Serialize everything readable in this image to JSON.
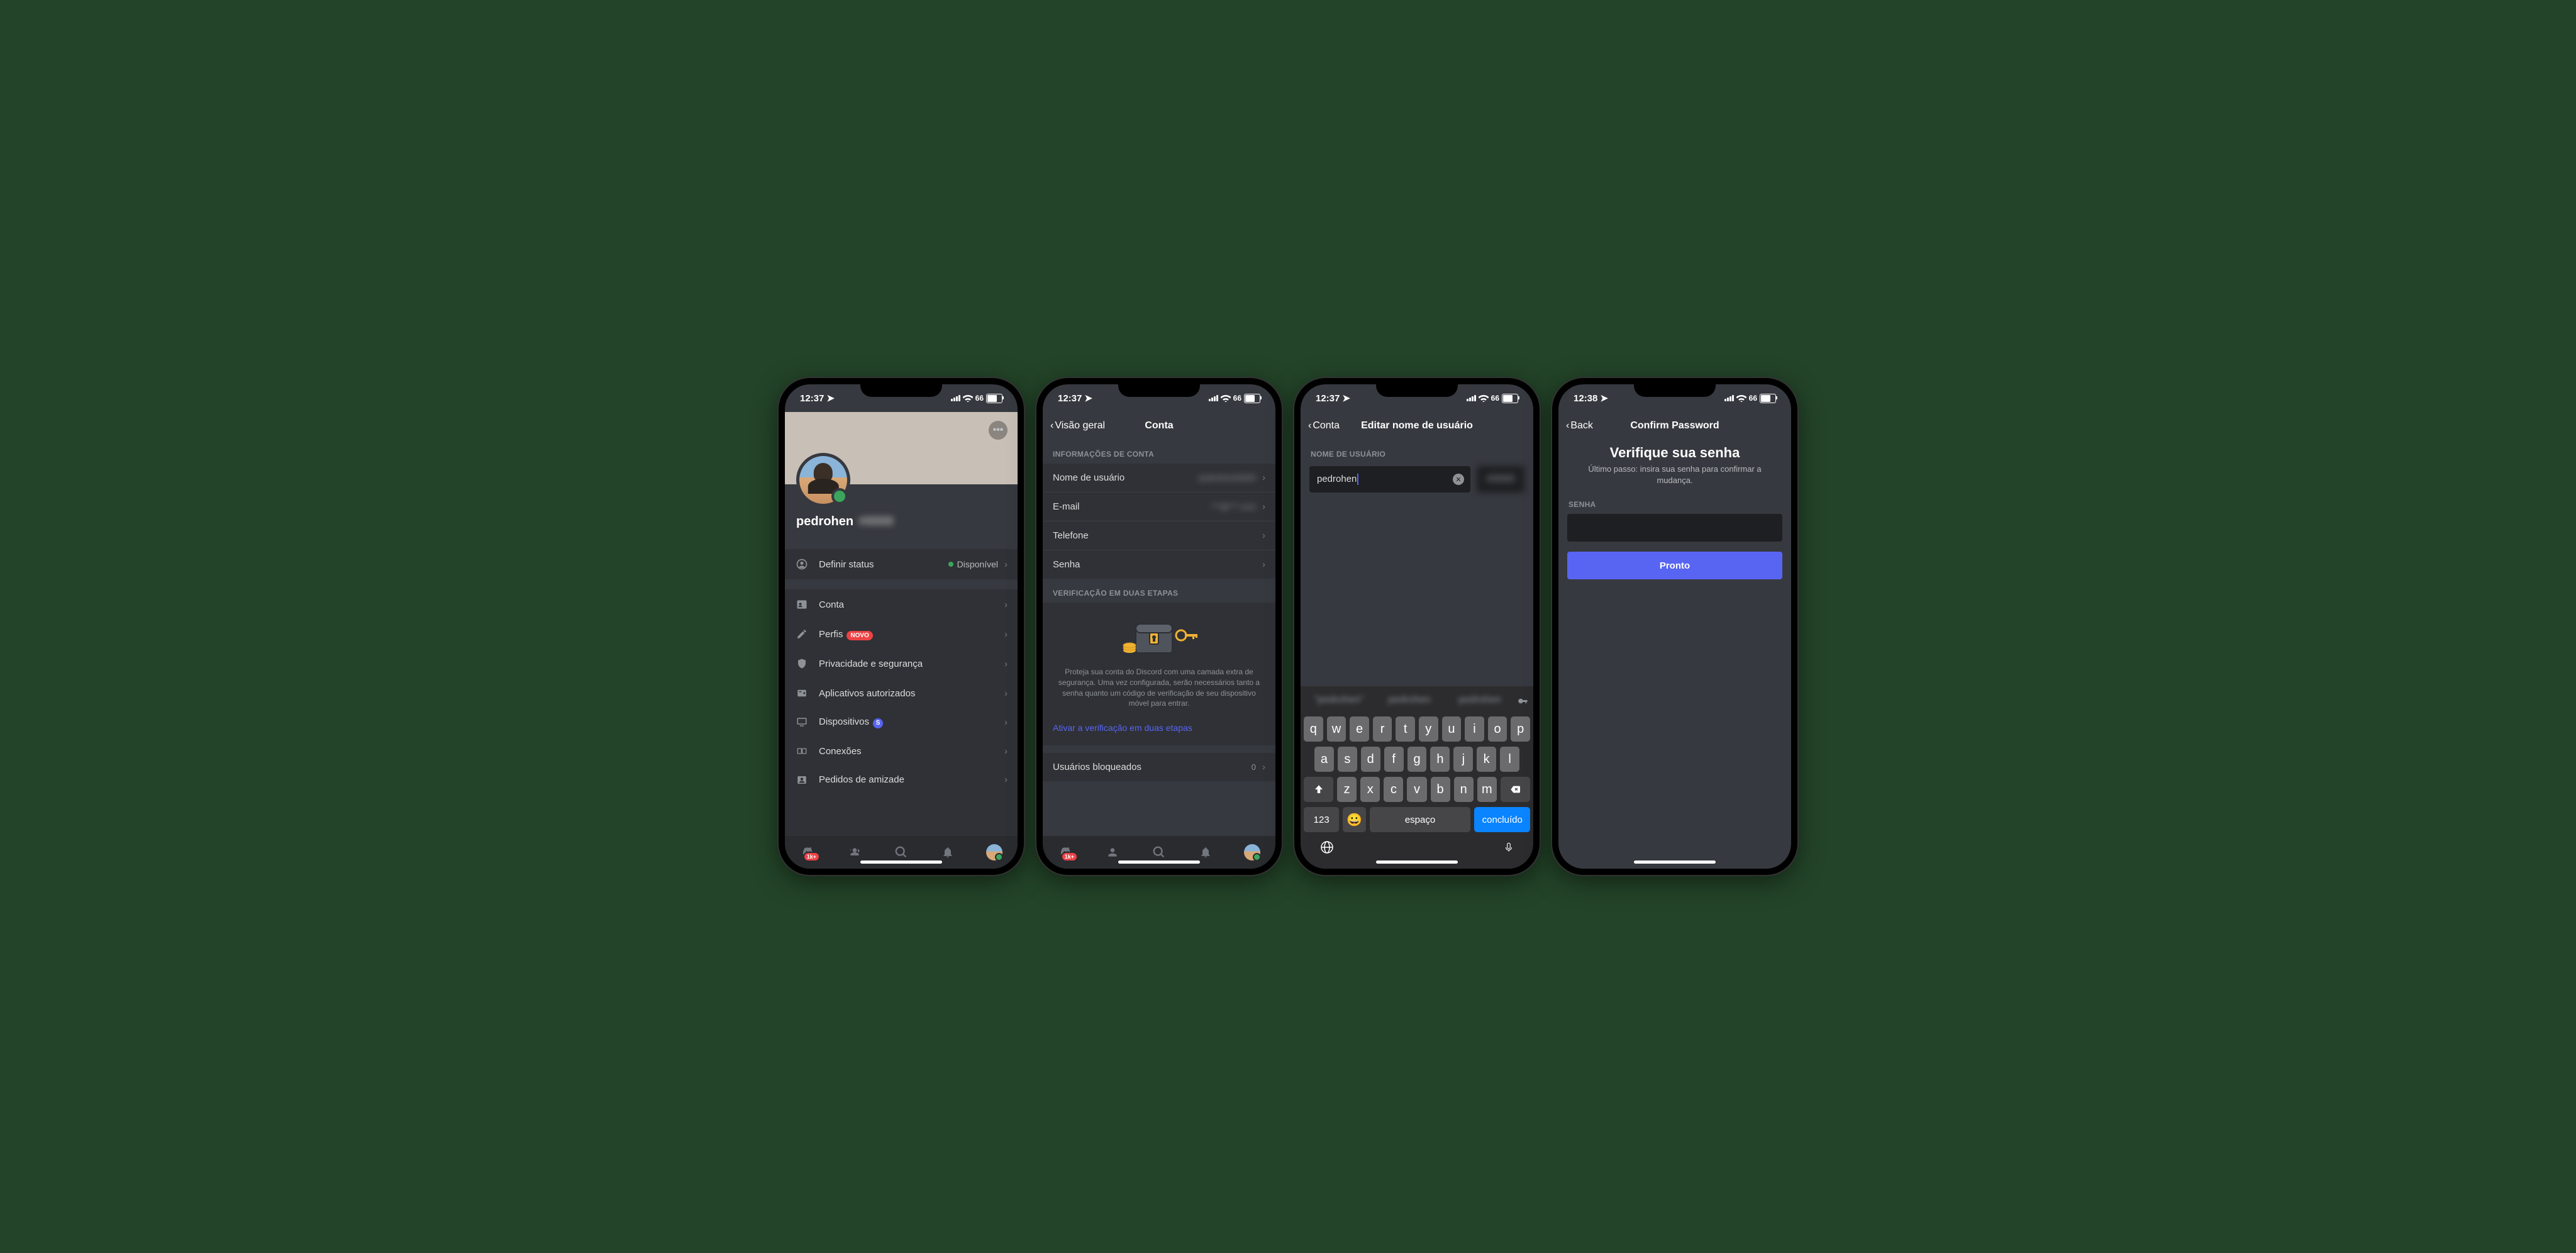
{
  "status_bar": {
    "time1": "12:37",
    "time2": "12:37",
    "time3": "12:37",
    "time4": "12:38",
    "battery": "66"
  },
  "screen1": {
    "username": "pedrohen",
    "status_label": "Definir status",
    "status_value": "Disponível",
    "menu": {
      "account": "Conta",
      "profiles": "Perfis",
      "new_badge": "NOVO",
      "privacy": "Privacidade e segurança",
      "authorized_apps": "Aplicativos autorizados",
      "devices": "Dispositivos",
      "devices_badge": "S",
      "connections": "Conexões",
      "friend_requests": "Pedidos de amizade"
    },
    "tab_badge": "1k+"
  },
  "screen2": {
    "back": "Visão geral",
    "title": "Conta",
    "section_info": "INFORMAÇÕES DE CONTA",
    "rows": {
      "username": "Nome de usuário",
      "email": "E-mail",
      "phone": "Telefone",
      "password": "Senha"
    },
    "section_2fa": "VERIFICAÇÃO EM DUAS ETAPAS",
    "twofa_desc": "Proteja sua conta do Discord com uma camada extra de segurança. Uma vez configurada, serão necessários tanto a senha quanto um código de verificação de seu dispositivo móvel para entrar.",
    "twofa_link": "Ativar a verificação em duas etapas",
    "blocked_users": "Usuários bloqueados",
    "blocked_count": "0"
  },
  "screen3": {
    "back": "Conta",
    "title": "Editar nome de usuário",
    "field_label": "NOME DE USUÁRIO",
    "field_value": "pedrohen",
    "keyboard": {
      "row1": [
        "q",
        "w",
        "e",
        "r",
        "t",
        "y",
        "u",
        "i",
        "o",
        "p"
      ],
      "row2": [
        "a",
        "s",
        "d",
        "f",
        "g",
        "h",
        "j",
        "k",
        "l"
      ],
      "row3": [
        "z",
        "x",
        "c",
        "v",
        "b",
        "n",
        "m"
      ],
      "numbers": "123",
      "space": "espaço",
      "done": "concluído"
    }
  },
  "screen4": {
    "back": "Back",
    "title": "Confirm Password",
    "heading": "Verifique sua senha",
    "subtitle": "Último passo: insira sua senha para confirmar a mudança.",
    "field_label": "SENHA",
    "button": "Pronto"
  }
}
